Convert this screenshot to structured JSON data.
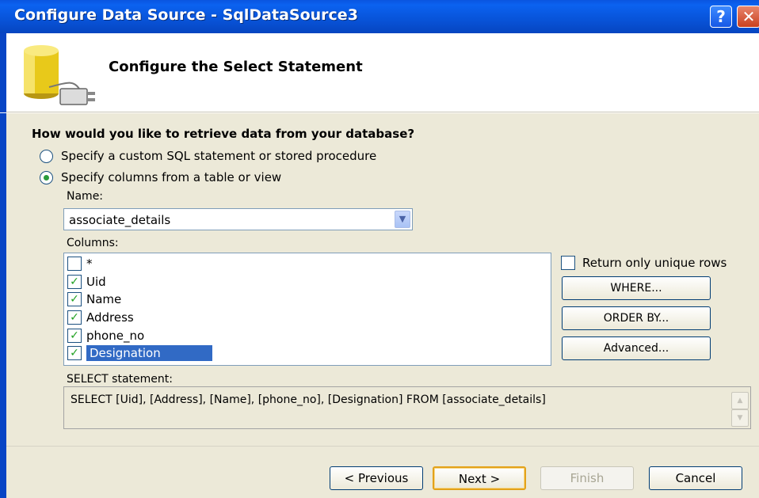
{
  "window": {
    "title": "Configure Data Source - SqlDataSource3",
    "help_glyph": "?",
    "close_glyph": "✕"
  },
  "header": {
    "heading": "Configure the Select Statement",
    "icon": "database-connector-icon"
  },
  "question": "How would you like to retrieve data from your database?",
  "radios": [
    {
      "label": "Specify a custom SQL statement or stored procedure",
      "checked": false
    },
    {
      "label": "Specify columns from a table or view",
      "checked": true
    }
  ],
  "name_label": "Name:",
  "name_value": "associate_details",
  "columns_label": "Columns:",
  "columns": [
    {
      "label": "*",
      "checked": false
    },
    {
      "label": "Uid",
      "checked": true
    },
    {
      "label": "Name",
      "checked": true
    },
    {
      "label": "Address",
      "checked": true
    },
    {
      "label": "phone_no",
      "checked": true
    },
    {
      "label": "Designation",
      "checked": true,
      "selected": true
    }
  ],
  "unique_rows_label": "Return only unique rows",
  "side_buttons": {
    "where": "WHERE...",
    "order_by": "ORDER BY...",
    "advanced": "Advanced..."
  },
  "select_label": "SELECT statement:",
  "select_statement": "SELECT [Uid], [Address], [Name], [phone_no], [Designation] FROM [associate_details]",
  "footer": {
    "previous": "< Previous",
    "next": "Next >",
    "finish": "Finish",
    "cancel": "Cancel"
  },
  "colors": {
    "titlebar": "#0853d8",
    "dialog_bg": "#ece9d8",
    "selection": "#316ac5",
    "check": "#21a121"
  }
}
